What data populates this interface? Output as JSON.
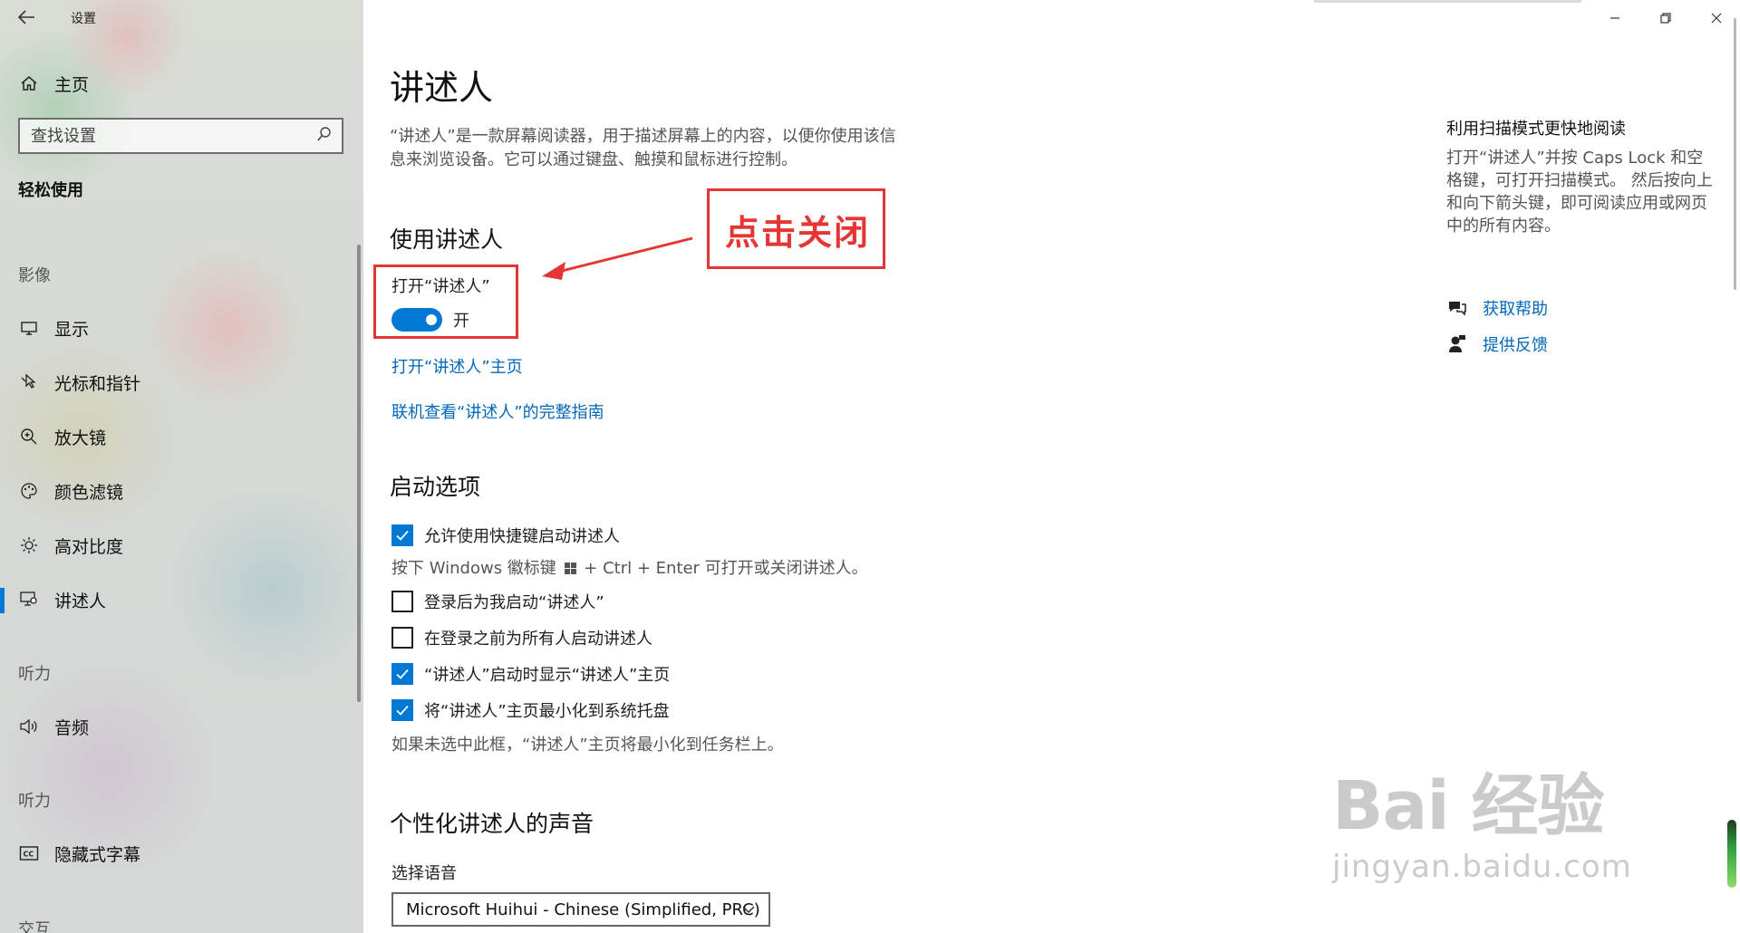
{
  "window": {
    "title": "设置",
    "minimize_glyph": "—",
    "restore_glyph": "❐",
    "close_glyph": "✕"
  },
  "sidebar": {
    "home": "主页",
    "search_placeholder": "查找设置",
    "category": "轻松使用",
    "groups": {
      "vision": "影像",
      "hearing": "听力",
      "interaction": "交互"
    },
    "items": {
      "display": "显示",
      "cursor": "光标和指针",
      "magnifier": "放大镜",
      "color_filter": "颜色滤镜",
      "high_contrast": "高对比度",
      "narrator": "讲述人",
      "audio": "音频",
      "captions": "隐藏式字幕"
    }
  },
  "main": {
    "title": "讲述人",
    "description": "“讲述人”是一款屏幕阅读器，用于描述屏幕上的内容，以便你使用该信息来浏览设备。它可以通过键盘、触摸和鼠标进行控制。",
    "use_section": "使用讲述人",
    "toggle_label": "打开“讲述人”",
    "toggle_state": "开",
    "toggle_on": true,
    "link_home": "打开“讲述人”主页",
    "link_guide": "联机查看“讲述人”的完整指南",
    "startup_section": "启动选项",
    "cb_shortcut": "允许使用快捷键启动讲述人",
    "hint_shortcut_pre": "按下 Windows 徽标键",
    "hint_shortcut_post": "+ Ctrl + Enter 可打开或关闭讲述人。",
    "cb_after_login": "登录后为我启动“讲述人”",
    "cb_before_login": "在登录之前为所有人启动讲述人",
    "cb_show_home": "“讲述人”启动时显示“讲述人”主页",
    "cb_minimize": "将“讲述人”主页最小化到系统托盘",
    "hint_minimize": "如果未选中此框，“讲述人”主页将最小化到任务栏上。",
    "voice_section": "个性化讲述人的声音",
    "select_label": "选择语音",
    "select_value": "Microsoft Huihui - Chinese (Simplified, PRC)",
    "checkboxes": {
      "shortcut": true,
      "after_login": false,
      "before_login": false,
      "show_home": true,
      "minimize": true
    }
  },
  "right_panel": {
    "title": "利用扫描模式更快地阅读",
    "body": "打开“讲述人”并按 Caps Lock 和空格键，可打开扫描模式。 然后按向上和向下箭头键，即可阅读应用或网页中的所有内容。",
    "get_help": "获取帮助",
    "feedback": "提供反馈"
  },
  "annotation": {
    "text": "点击关闭",
    "color": "#e53535"
  },
  "watermark": {
    "line1": "Bai 经验",
    "line2": "jingyan.baidu.com"
  },
  "colors": {
    "accent": "#0078d4",
    "link": "#0067b8"
  }
}
